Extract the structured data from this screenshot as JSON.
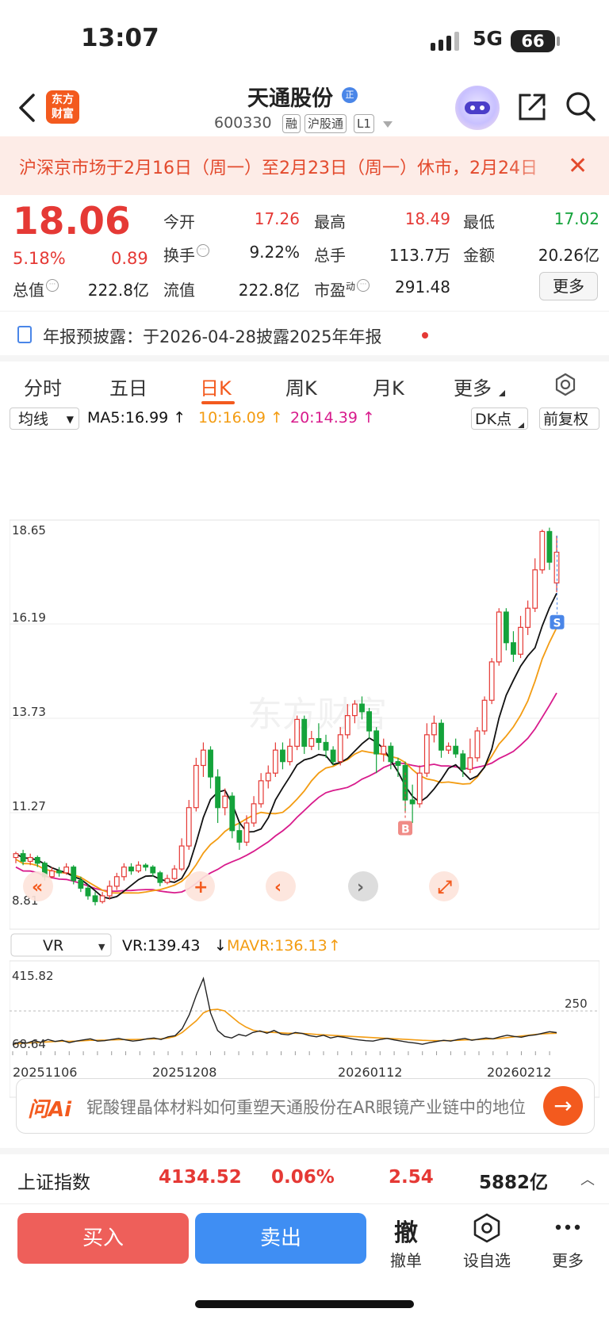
{
  "status_bar": {
    "time": "13:07",
    "network": "5G",
    "battery": "66"
  },
  "header": {
    "logo_text": "东方财富",
    "stock_name": "天通股份",
    "name_badge": "正",
    "stock_code": "600330",
    "tags": [
      "融",
      "沪股通",
      "L1"
    ]
  },
  "notice": {
    "text": "沪深京市场于2月16日（周一）至2月23日（周一）休市，2月24日"
  },
  "quote": {
    "price": "18.06",
    "change_pct": "5.18%",
    "change": "0.89",
    "fields": [
      {
        "label": "今开",
        "value": "17.26",
        "color": "#e53935"
      },
      {
        "label": "最高",
        "value": "18.49",
        "color": "#e53935"
      },
      {
        "label": "最低",
        "value": "17.02",
        "color": "#14a33b"
      },
      {
        "label": "换手",
        "value": "9.22%",
        "color": "#222222"
      },
      {
        "label": "总手",
        "value": "113.7万",
        "color": "#222222"
      },
      {
        "label": "金额",
        "value": "20.26亿",
        "color": "#222222"
      },
      {
        "label": "总值",
        "value": "222.8亿",
        "color": "#222222"
      },
      {
        "label": "流值",
        "value": "222.8亿",
        "color": "#222222"
      },
      {
        "label": "市盈",
        "label_sup": "动",
        "value": "291.48",
        "color": "#222222"
      }
    ],
    "more_label": "更多"
  },
  "announcement": {
    "text": "年报预披露：于2026-04-28披露2025年年报"
  },
  "tabs": [
    {
      "label": "分时"
    },
    {
      "label": "五日"
    },
    {
      "label": "日K",
      "active": true
    },
    {
      "label": "周K"
    },
    {
      "label": "月K"
    },
    {
      "label": "更多"
    }
  ],
  "ma_bar": {
    "indicator": "均线",
    "ma5": "MA5:16.99",
    "ma10": "10:16.09",
    "ma20": "20:14.39",
    "dk_label": "DK点",
    "adjust_label": "前复权"
  },
  "colors": {
    "up": "#e53935",
    "down": "#14a33b",
    "ma5": "#111111",
    "ma10": "#f39c12",
    "ma20": "#d81b8c",
    "accent": "#f35a1e"
  },
  "chart_data": [
    {
      "type": "candlestick",
      "y_ticks": [
        "18.65",
        "16.19",
        "13.73",
        "11.27",
        "8.81"
      ],
      "ylim": [
        8.81,
        18.65
      ],
      "watermark": "东方财富",
      "markers": [
        {
          "label": "B"
        },
        {
          "label": "S"
        }
      ],
      "candles": [
        [
          10.1,
          10.2,
          9.95,
          10.25
        ],
        [
          10.2,
          10.0,
          9.9,
          10.3
        ],
        [
          10.0,
          10.1,
          9.9,
          10.2
        ],
        [
          10.1,
          9.95,
          9.85,
          10.15
        ],
        [
          9.95,
          9.6,
          9.5,
          10.0
        ],
        [
          9.6,
          9.75,
          9.55,
          9.85
        ],
        [
          9.75,
          9.7,
          9.6,
          9.85
        ],
        [
          9.7,
          9.85,
          9.65,
          9.95
        ],
        [
          9.85,
          9.5,
          9.4,
          9.9
        ],
        [
          9.5,
          9.3,
          9.2,
          9.6
        ],
        [
          9.3,
          9.1,
          9.0,
          9.4
        ],
        [
          9.1,
          8.95,
          8.85,
          9.2
        ],
        [
          8.95,
          9.1,
          8.9,
          9.2
        ],
        [
          9.1,
          9.35,
          9.0,
          9.5
        ],
        [
          9.35,
          9.6,
          9.25,
          9.7
        ],
        [
          9.6,
          9.85,
          9.5,
          9.95
        ],
        [
          9.85,
          9.75,
          9.65,
          9.95
        ],
        [
          9.75,
          9.9,
          9.7,
          10.0
        ],
        [
          9.9,
          9.85,
          9.75,
          9.95
        ],
        [
          9.85,
          9.7,
          9.6,
          9.9
        ],
        [
          9.7,
          9.45,
          9.35,
          9.75
        ],
        [
          9.45,
          9.55,
          9.4,
          9.65
        ],
        [
          9.55,
          9.8,
          9.5,
          9.9
        ],
        [
          9.8,
          10.4,
          9.75,
          10.6
        ],
        [
          10.4,
          11.4,
          10.3,
          11.6
        ],
        [
          11.4,
          12.5,
          11.3,
          12.7
        ],
        [
          12.5,
          12.9,
          12.2,
          13.1
        ],
        [
          12.9,
          12.2,
          11.9,
          13.0
        ],
        [
          12.2,
          11.4,
          11.0,
          12.4
        ],
        [
          11.4,
          11.7,
          11.2,
          11.9
        ],
        [
          11.7,
          10.8,
          10.6,
          11.8
        ],
        [
          10.8,
          10.5,
          10.3,
          11.0
        ],
        [
          10.5,
          11.0,
          10.4,
          11.2
        ],
        [
          11.0,
          11.5,
          10.9,
          11.7
        ],
        [
          11.5,
          12.1,
          11.4,
          12.3
        ],
        [
          12.1,
          12.3,
          11.9,
          12.5
        ],
        [
          12.3,
          12.9,
          12.2,
          13.1
        ],
        [
          12.9,
          12.6,
          12.4,
          13.1
        ],
        [
          12.6,
          13.0,
          12.5,
          13.2
        ],
        [
          13.0,
          13.7,
          12.9,
          13.8
        ],
        [
          13.7,
          13.0,
          12.8,
          13.8
        ],
        [
          13.0,
          13.2,
          12.9,
          13.4
        ],
        [
          13.2,
          13.1,
          12.9,
          13.6
        ],
        [
          13.1,
          12.9,
          12.7,
          13.3
        ],
        [
          12.9,
          12.6,
          12.5,
          13.0
        ],
        [
          12.6,
          13.3,
          12.5,
          13.5
        ],
        [
          13.3,
          13.8,
          13.2,
          14.1
        ],
        [
          13.8,
          14.1,
          13.6,
          14.2
        ],
        [
          14.1,
          13.9,
          13.7,
          14.3
        ],
        [
          13.9,
          13.4,
          13.2,
          14.0
        ],
        [
          13.4,
          12.8,
          12.3,
          13.5
        ],
        [
          12.8,
          13.0,
          12.6,
          13.2
        ],
        [
          13.0,
          12.6,
          12.4,
          13.1
        ],
        [
          12.6,
          12.5,
          12.2,
          12.7
        ],
        [
          12.5,
          11.6,
          11.3,
          12.6
        ],
        [
          11.6,
          11.5,
          11.0,
          12.0
        ],
        [
          11.5,
          12.3,
          11.4,
          12.5
        ],
        [
          12.3,
          13.3,
          12.2,
          13.6
        ],
        [
          13.3,
          13.6,
          13.1,
          13.8
        ],
        [
          13.6,
          12.9,
          12.7,
          13.7
        ],
        [
          12.9,
          13.0,
          12.8,
          13.1
        ],
        [
          13.0,
          12.8,
          12.7,
          13.2
        ],
        [
          12.8,
          12.4,
          12.2,
          12.9
        ],
        [
          12.4,
          12.7,
          12.3,
          13.2
        ],
        [
          12.7,
          13.4,
          12.6,
          13.5
        ],
        [
          13.4,
          14.2,
          13.3,
          14.3
        ],
        [
          14.2,
          15.2,
          14.1,
          15.3
        ],
        [
          15.2,
          16.5,
          15.1,
          16.6
        ],
        [
          16.5,
          15.7,
          15.5,
          16.6
        ],
        [
          15.7,
          15.4,
          15.2,
          16.0
        ],
        [
          15.4,
          16.1,
          15.3,
          16.4
        ],
        [
          16.1,
          16.6,
          15.9,
          16.8
        ],
        [
          16.6,
          17.6,
          16.5,
          17.9
        ],
        [
          17.6,
          18.6,
          17.5,
          18.65
        ],
        [
          18.6,
          17.8,
          17.6,
          18.7
        ],
        [
          17.26,
          18.06,
          17.02,
          18.49
        ]
      ],
      "ma5_last": 16.99,
      "ma10_last": 16.09,
      "ma20_last": 14.39
    },
    {
      "type": "line",
      "indicator": "VR",
      "vr_label": "VR:139.43",
      "mavr_label": "MAVR:136.13",
      "y_ticks": [
        "415.82",
        "68.64"
      ],
      "ref_line": {
        "value": 250,
        "label": "250"
      },
      "ylim": [
        68.64,
        415.82
      ],
      "x_ticks": [
        "20251106",
        "20251208",
        "20260112",
        "20260212"
      ],
      "vr": [
        78,
        92,
        86,
        98,
        90,
        104,
        94,
        100,
        88,
        96,
        102,
        108,
        96,
        98,
        104,
        110,
        102,
        96,
        100,
        108,
        112,
        104,
        118,
        124,
        160,
        230,
        330,
        415,
        240,
        150,
        120,
        112,
        130,
        122,
        140,
        148,
        136,
        150,
        132,
        128,
        140,
        135,
        124,
        118,
        126,
        112,
        120,
        115,
        108,
        102,
        98,
        96,
        104,
        110,
        102,
        96,
        90,
        86,
        80,
        88,
        94,
        100,
        96,
        104,
        110,
        100,
        106,
        112,
        108,
        118,
        126,
        120,
        116,
        124,
        128,
        136,
        144,
        139.43
      ],
      "mavr": [
        80,
        84,
        86,
        88,
        90,
        92,
        94,
        96,
        95,
        96,
        98,
        100,
        100,
        101,
        102,
        103,
        104,
        104,
        105,
        106,
        107,
        108,
        112,
        120,
        140,
        170,
        200,
        240,
        255,
        258,
        250,
        220,
        190,
        168,
        152,
        145,
        142,
        140,
        138,
        136,
        136,
        135,
        133,
        130,
        128,
        126,
        124,
        122,
        120,
        118,
        116,
        114,
        112,
        110,
        108,
        106,
        104,
        102,
        100,
        99,
        98,
        98,
        99,
        100,
        102,
        103,
        104,
        106,
        108,
        110,
        114,
        118,
        122,
        126,
        130,
        133,
        135,
        136.13
      ]
    }
  ],
  "ai_bar": {
    "logo": "问Ai",
    "question": "铌酸锂晶体材料如何重塑天通股份在AR眼镜产业链中的地位"
  },
  "index_bar": {
    "name": "上证指数",
    "value": "4134.52",
    "pct": "0.06%",
    "change": "2.54",
    "amount": "5882亿"
  },
  "bottom": {
    "buy": "买入",
    "sell": "卖出",
    "cancel_glyph": "撤",
    "cancel": "撤单",
    "watch": "设自选",
    "more": "更多"
  }
}
